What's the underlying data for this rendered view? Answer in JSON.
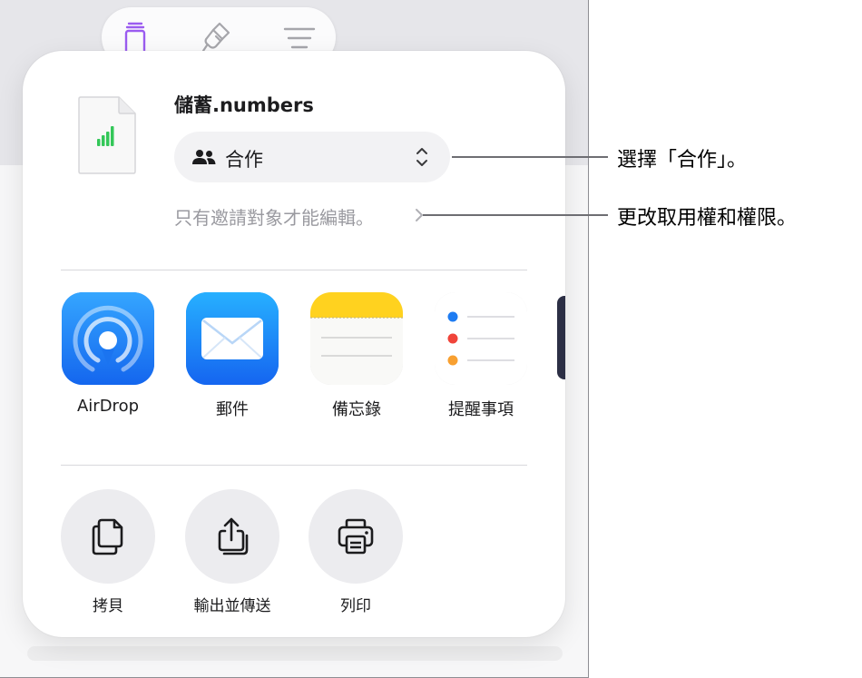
{
  "toolbar": {
    "icons": [
      "table-insert-icon",
      "format-brush-icon",
      "document-options-icon"
    ],
    "accent": "#9b5cf0"
  },
  "share_sheet": {
    "file_name": "儲蓄.numbers",
    "collaboration": {
      "selected": "合作",
      "access_summary": "只有邀請對象才能編輯。"
    },
    "apps": [
      {
        "label": "AirDrop",
        "icon": "airdrop-icon"
      },
      {
        "label": "郵件",
        "icon": "mail-icon"
      },
      {
        "label": "備忘錄",
        "icon": "notes-icon"
      },
      {
        "label": "提醒事項",
        "icon": "reminders-icon"
      }
    ],
    "actions": [
      {
        "label": "拷貝",
        "icon": "copy-icon"
      },
      {
        "label": "輸出並傳送",
        "icon": "export-share-icon"
      },
      {
        "label": "列印",
        "icon": "print-icon"
      }
    ]
  },
  "callouts": [
    {
      "text": "選擇「合作」。"
    },
    {
      "text": "更改取用權和權限。"
    }
  ],
  "colors": {
    "numbers_green": "#34c759",
    "airdrop_blue": "#1f7cf5",
    "mail_blue": "#1a8cff",
    "notes_yellow": "#ffd21f"
  }
}
